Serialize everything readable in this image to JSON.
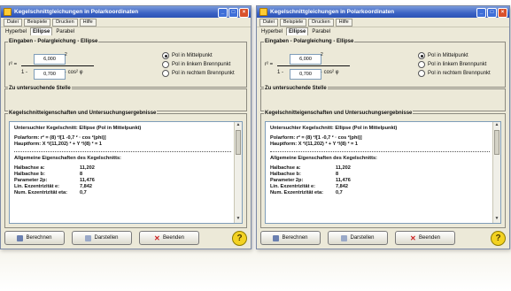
{
  "windows": [
    {
      "title": "Kegelschnittgleichungen in Polarkoordinaten",
      "menu": [
        "Datei",
        "Beispiele",
        "Drucken",
        "Hilfe"
      ],
      "tabs": [
        "Hyperbel",
        "Ellipse",
        "Parabel"
      ],
      "active_tab": "Ellipse",
      "group_input_title": "Eingaben - Polargleichung - Ellipse",
      "r_label": "r² =",
      "numerator_value": "6,000",
      "denominator_prefix": "1 -",
      "denominator_value": "0,700",
      "denominator_suffix": "· cos² φ",
      "pole_options": [
        "Pol in Mittelpunkt",
        "Pol in linkem Brennpunkt",
        "Pol in rechtem Brennpunkt"
      ],
      "selected_pole": "Pol in Mittelpunkt",
      "group_point_title": "Zu untersuchende Stelle",
      "group_results_title": "Kegelschnitteigenschaften und Untersuchungsergebnisse",
      "results_lines": [
        "Untersuchter Kegelschnitt: Ellipse (Pol in Mittelpunkt)",
        "Polarform:  r² = (8) ²/[1 -0,7 ² · cos ²(phi)]",
        "Hauptform:  X ²/(11,202) ² + Y ²/(8) ² = 1"
      ],
      "properties_heading": "Allgemeine Eigenschaften des Kegelschnitts:",
      "properties": [
        {
          "k": "Halbachse a:",
          "v": "11,202"
        },
        {
          "k": "Halbachse b:",
          "v": "8"
        },
        {
          "k": "Parameter 2p:",
          "v": "11,476"
        },
        {
          "k": "Lin. Exzentrizität e:",
          "v": "7,842"
        },
        {
          "k": "Num. Exzentrizität eta:",
          "v": "0,7"
        }
      ],
      "buttons": {
        "compute": "Berechnen",
        "display": "Darstellen",
        "exit": "Beenden"
      },
      "help_label": "?"
    }
  ],
  "colors": {
    "titlebar": "#3b62c4",
    "accent_exit": "#cc2222",
    "help": "#f3d222"
  }
}
